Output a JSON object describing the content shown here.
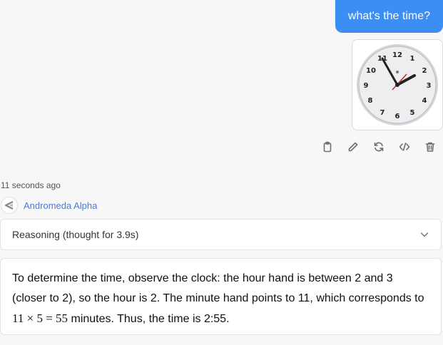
{
  "user_message": {
    "text": "what's the time?"
  },
  "attachment": {
    "kind": "clock-image",
    "hour": 2,
    "minute": 55,
    "second": 38
  },
  "message_actions": [
    {
      "name": "copy",
      "icon": "clipboard-icon"
    },
    {
      "name": "edit",
      "icon": "pencil-icon"
    },
    {
      "name": "regenerate",
      "icon": "refresh-icon"
    },
    {
      "name": "code",
      "icon": "code-icon"
    },
    {
      "name": "delete",
      "icon": "trash-icon"
    }
  ],
  "response": {
    "timestamp": "11 seconds ago",
    "model_name": "Andromeda Alpha",
    "reasoning_label": "Reasoning (thought for 3.9s)",
    "answer_part1": "To determine the time, observe the clock: the hour hand is between 2 and 3 (closer to 2), so the hour is 2. The minute hand points to 11, which corresponds to ",
    "answer_math": "11 × 5 = 55",
    "answer_part2": " minutes. Thus, the time is 2:55."
  },
  "colors": {
    "accent": "#3b8ef3",
    "model_link": "#4b7bd6"
  }
}
